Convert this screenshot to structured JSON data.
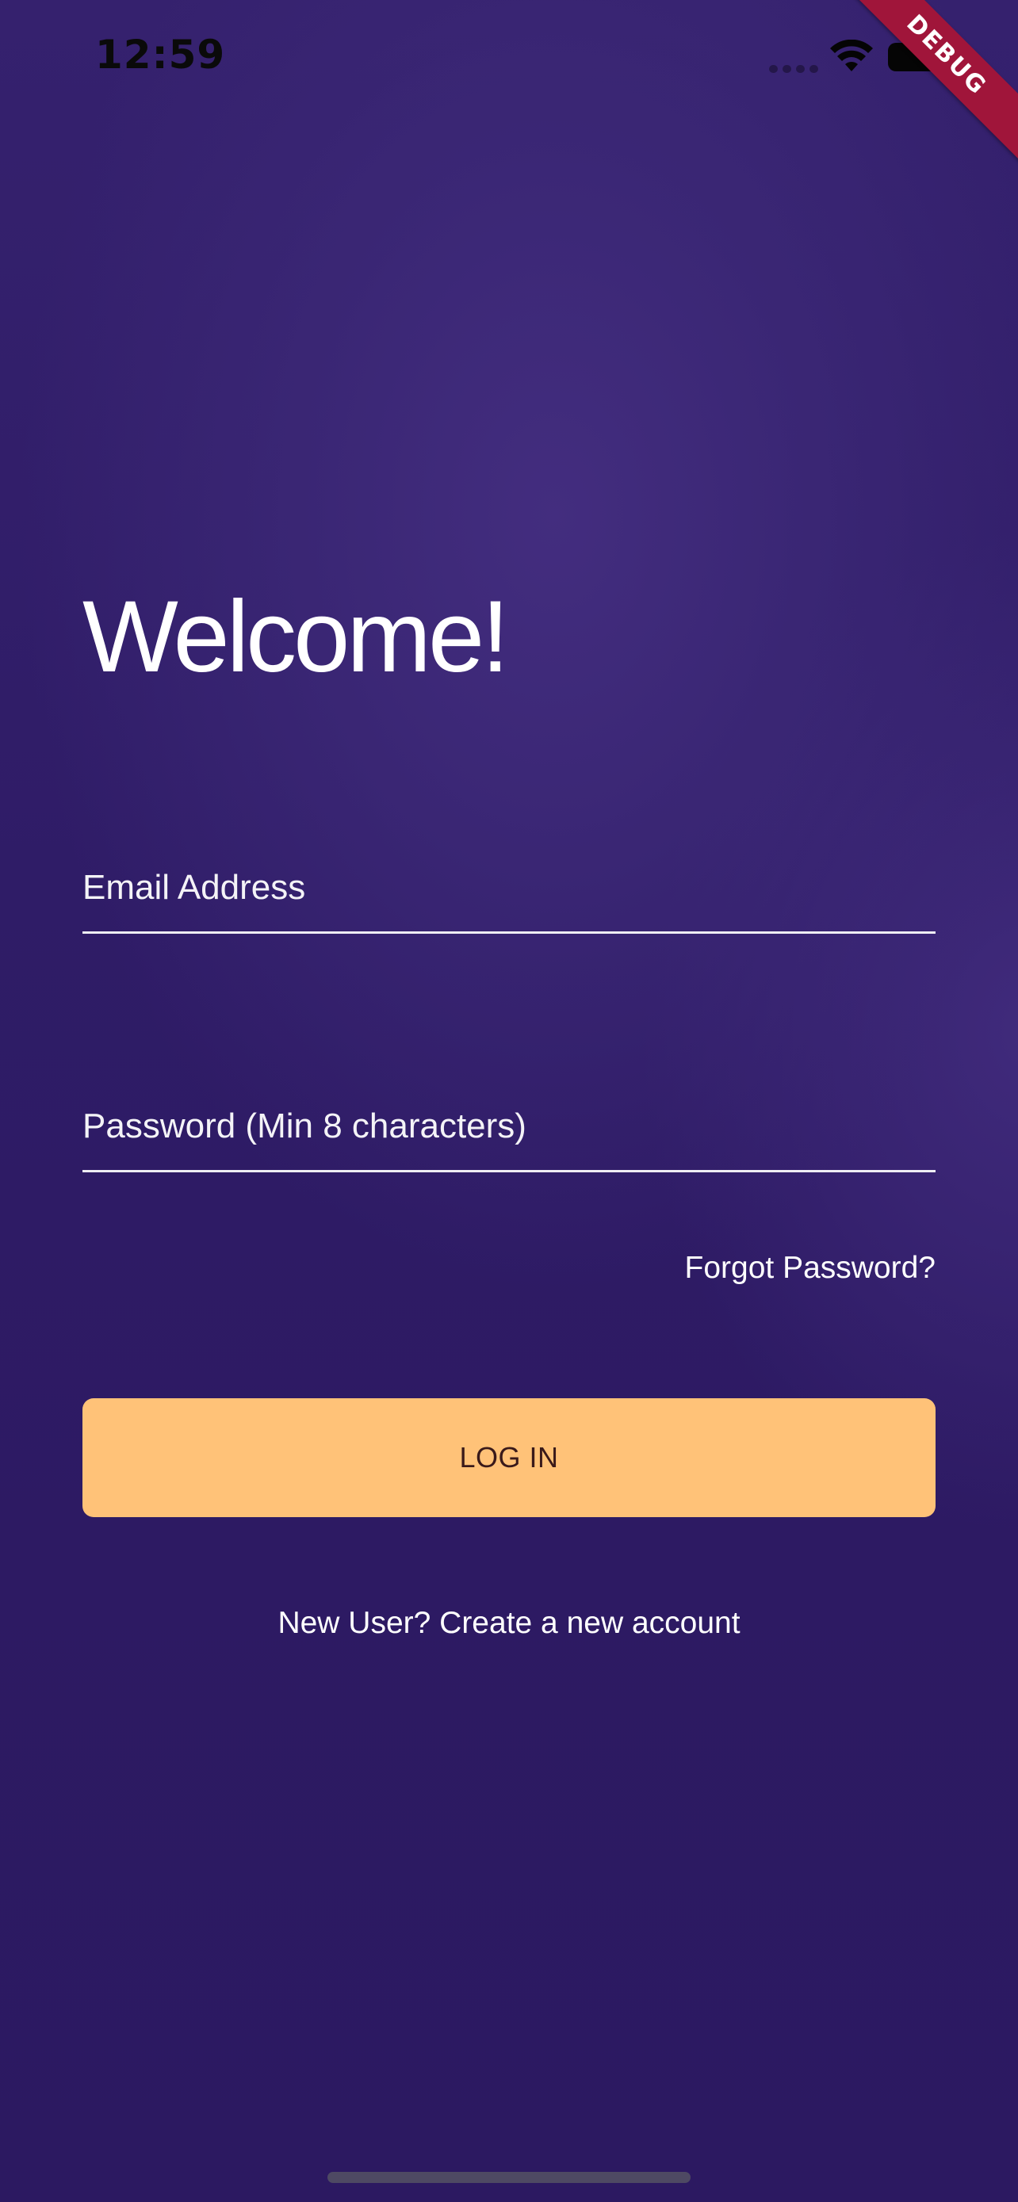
{
  "status_bar": {
    "time": "12:59",
    "icons": [
      "signal-dots-icon",
      "wifi-icon",
      "battery-icon"
    ]
  },
  "debug_banner": {
    "label": "DEBUG",
    "color": "#a0153a"
  },
  "login": {
    "title": "Welcome!",
    "email_placeholder": "Email Address",
    "email_value": "",
    "password_placeholder": "Password (Min 8 characters)",
    "password_value": "",
    "forgot_password_label": "Forgot Password?",
    "login_button_label": "LOG IN",
    "signup_label": "New User? Create a new account"
  },
  "colors": {
    "background": "#2d1a64",
    "accent_button": "#ffc278",
    "text": "#ffffff"
  }
}
